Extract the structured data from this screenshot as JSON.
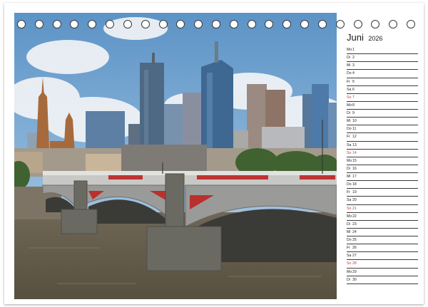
{
  "calendar": {
    "month": "Juni",
    "year": "2026",
    "days": [
      {
        "weekday": "Mo",
        "day": "1"
      },
      {
        "weekday": "Di",
        "day": "2"
      },
      {
        "weekday": "Mi",
        "day": "3"
      },
      {
        "weekday": "Do",
        "day": "4"
      },
      {
        "weekday": "Fr",
        "day": "5"
      },
      {
        "weekday": "Sa",
        "day": "6"
      },
      {
        "weekday": "So",
        "day": "7",
        "sunday": true
      },
      {
        "weekday": "Mo",
        "day": "8"
      },
      {
        "weekday": "Di",
        "day": "9"
      },
      {
        "weekday": "Mi",
        "day": "10"
      },
      {
        "weekday": "Do",
        "day": "11"
      },
      {
        "weekday": "Fr",
        "day": "12"
      },
      {
        "weekday": "Sa",
        "day": "13"
      },
      {
        "weekday": "So",
        "day": "14",
        "sunday": true
      },
      {
        "weekday": "Mo",
        "day": "15"
      },
      {
        "weekday": "Di",
        "day": "16"
      },
      {
        "weekday": "Mi",
        "day": "17"
      },
      {
        "weekday": "Do",
        "day": "18"
      },
      {
        "weekday": "Fr",
        "day": "19"
      },
      {
        "weekday": "Sa",
        "day": "20"
      },
      {
        "weekday": "So",
        "day": "21",
        "sunday": true
      },
      {
        "weekday": "Mo",
        "day": "22"
      },
      {
        "weekday": "Di",
        "day": "23"
      },
      {
        "weekday": "Mi",
        "day": "24"
      },
      {
        "weekday": "Do",
        "day": "25"
      },
      {
        "weekday": "Fr",
        "day": "26"
      },
      {
        "weekday": "Sa",
        "day": "27"
      },
      {
        "weekday": "So",
        "day": "28",
        "sunday": true
      },
      {
        "weekday": "Mo",
        "day": "29"
      },
      {
        "weekday": "Di",
        "day": "30"
      }
    ]
  },
  "colors": {
    "sunday": "#c43a3a",
    "ruling": "#3a3a3a",
    "binding_holes": "#3a3a3a"
  },
  "binding": {
    "hole_count": 23
  }
}
